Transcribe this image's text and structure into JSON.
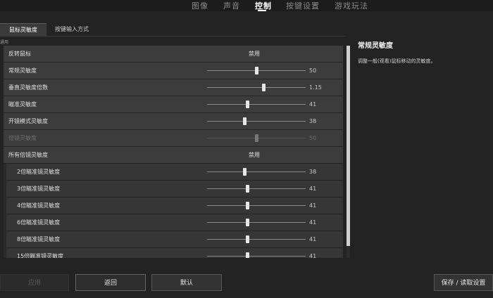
{
  "nav": {
    "tabs": [
      {
        "label": "图像"
      },
      {
        "label": "声音"
      },
      {
        "label": "控制"
      },
      {
        "label": "按键设置"
      },
      {
        "label": "游戏玩法"
      }
    ],
    "active_tab": "控制"
  },
  "subtabs": [
    {
      "label": "鼠标灵敏度"
    },
    {
      "label": "按键输入方式"
    }
  ],
  "group_label": "通用",
  "settings": [
    {
      "label": "反转鼠标",
      "type": "toggle",
      "value": "禁用"
    },
    {
      "label": "常规灵敏度",
      "type": "slider",
      "value": "50",
      "fraction": 0.5
    },
    {
      "label": "垂直灵敏度倍数",
      "type": "slider",
      "value": "1.15",
      "fraction": 0.57
    },
    {
      "label": "瞄准灵敏度",
      "type": "slider",
      "value": "41",
      "fraction": 0.41
    },
    {
      "label": "开镜模式灵敏度",
      "type": "slider",
      "value": "38",
      "fraction": 0.38
    },
    {
      "label": "倍镜灵敏度",
      "type": "slider",
      "value": "50",
      "fraction": 0.5,
      "disabled": true
    },
    {
      "label": "所有倍镜灵敏度",
      "type": "toggle",
      "value": "禁用"
    },
    {
      "label": "2倍瞄准镜灵敏度",
      "type": "slider",
      "value": "38",
      "fraction": 0.38,
      "sub": true
    },
    {
      "label": "3倍瞄准镜灵敏度",
      "type": "slider",
      "value": "41",
      "fraction": 0.41,
      "sub": true
    },
    {
      "label": "4倍瞄准镜灵敏度",
      "type": "slider",
      "value": "41",
      "fraction": 0.41,
      "sub": true
    },
    {
      "label": "6倍瞄准镜灵敏度",
      "type": "slider",
      "value": "41",
      "fraction": 0.41,
      "sub": true
    },
    {
      "label": "8倍瞄准镜灵敏度",
      "type": "slider",
      "value": "41",
      "fraction": 0.41,
      "sub": true
    },
    {
      "label": "15倍瞄准镜灵敏度",
      "type": "slider",
      "value": "41",
      "fraction": 0.41,
      "sub": true
    }
  ],
  "info": {
    "title": "常规灵敏度",
    "description": "调整一般(观看)鼠标移动的灵敏度。"
  },
  "buttons": {
    "apply": "应用",
    "back": "返回",
    "default": "默认",
    "save_load": "保存 / 读取设置"
  }
}
